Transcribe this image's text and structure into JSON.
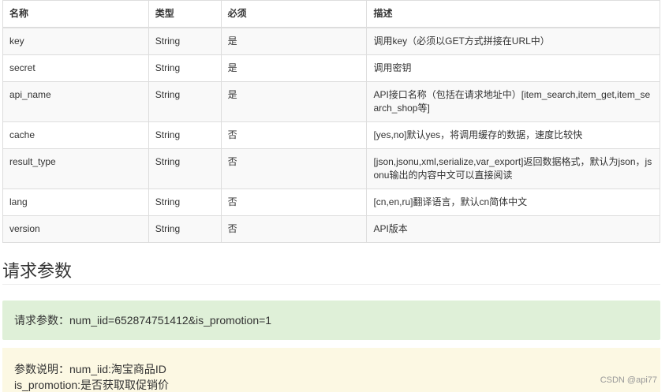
{
  "table": {
    "headers": [
      "名称",
      "类型",
      "必须",
      "描述"
    ],
    "rows": [
      [
        "key",
        "String",
        "是",
        "调用key（必须以GET方式拼接在URL中）"
      ],
      [
        "secret",
        "String",
        "是",
        "调用密钥"
      ],
      [
        "api_name",
        "String",
        "是",
        "API接口名称（包括在请求地址中）[item_search,item_get,item_search_shop等]"
      ],
      [
        "cache",
        "String",
        "否",
        "[yes,no]默认yes，将调用缓存的数据，速度比较快"
      ],
      [
        "result_type",
        "String",
        "否",
        "[json,jsonu,xml,serialize,var_export]返回数据格式，默认为json，jsonu输出的内容中文可以直接阅读"
      ],
      [
        "lang",
        "String",
        "否",
        "[cn,en,ru]翻译语言，默认cn简体中文"
      ],
      [
        "version",
        "String",
        "否",
        "API版本"
      ]
    ]
  },
  "section_title": "请求参数",
  "request_params": "请求参数：num_iid=652874751412&is_promotion=1",
  "param_desc": {
    "line1": "参数说明：num_iid:淘宝商品ID",
    "line2": "is_promotion:是否获取取促销价"
  },
  "watermark": "CSDN @api77"
}
